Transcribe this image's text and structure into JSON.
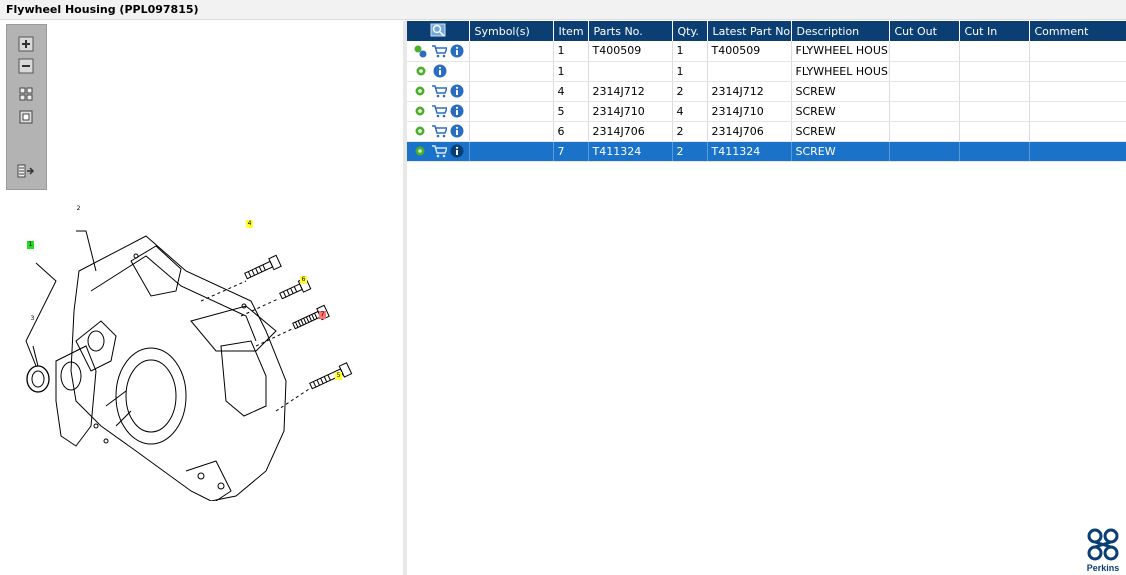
{
  "title": "Flywheel Housing (PPL097815)",
  "toolbar": {
    "zoom_in": "zoom-in",
    "zoom_out": "zoom-out",
    "fit": "fit-view",
    "actual": "actual-size",
    "layout": "toggle-layout"
  },
  "callouts": {
    "c1": "1",
    "c2": "2",
    "c3": "3",
    "c4": "4",
    "c5": "5",
    "c6": "6",
    "c7": "7"
  },
  "columns": [
    "Symbol(s)",
    "Item",
    "Parts No.",
    "Qty.",
    "Latest Part No.",
    "Description",
    "Cut Out",
    "Cut In",
    "Comment"
  ],
  "rows": [
    {
      "item": "1",
      "part": "T400509",
      "qty": "1",
      "latest": "T400509",
      "desc": "FLYWHEEL HOUSING",
      "cutout": "",
      "cutin": "",
      "comment": ""
    },
    {
      "item": "1",
      "part": "",
      "qty": "1",
      "latest": "",
      "desc": "FLYWHEEL HOUSING",
      "cutout": "",
      "cutin": "",
      "comment": ""
    },
    {
      "item": "4",
      "part": "2314J712",
      "qty": "2",
      "latest": "2314J712",
      "desc": "SCREW",
      "cutout": "",
      "cutin": "",
      "comment": ""
    },
    {
      "item": "5",
      "part": "2314J710",
      "qty": "4",
      "latest": "2314J710",
      "desc": "SCREW",
      "cutout": "",
      "cutin": "",
      "comment": ""
    },
    {
      "item": "6",
      "part": "2314J706",
      "qty": "2",
      "latest": "2314J706",
      "desc": "SCREW",
      "cutout": "",
      "cutin": "",
      "comment": ""
    },
    {
      "item": "7",
      "part": "T411324",
      "qty": "2",
      "latest": "T411324",
      "desc": "SCREW",
      "cutout": "",
      "cutin": "",
      "comment": ""
    }
  ],
  "brand": "Perkins",
  "colors": {
    "header": "#0b3f73",
    "selected": "#1a73c9",
    "gear": "#4caf2a",
    "cart": "#2a6cc0",
    "info": "#2a6cc0"
  }
}
